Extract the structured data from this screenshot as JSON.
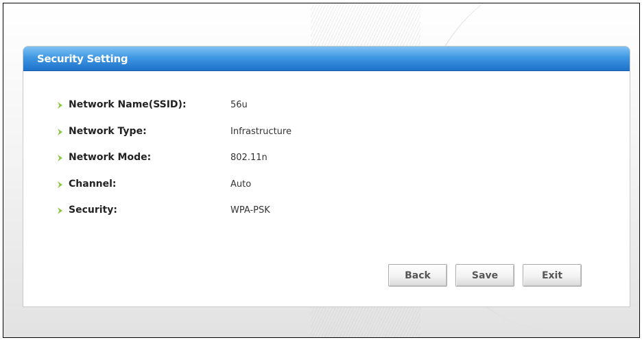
{
  "panel": {
    "title": "Security Setting"
  },
  "rows": [
    {
      "label": "Network Name(SSID):",
      "value": "56u"
    },
    {
      "label": "Network Type:",
      "value": "Infrastructure"
    },
    {
      "label": "Network Mode:",
      "value": "802.11n"
    },
    {
      "label": "Channel:",
      "value": "Auto"
    },
    {
      "label": "Security:",
      "value": "WPA-PSK"
    }
  ],
  "buttons": {
    "back": "Back",
    "save": "Save",
    "exit": "Exit"
  },
  "colors": {
    "header_blue": "#2f86d8",
    "bullet_green": "#8cc63e"
  },
  "icons": {
    "bullet": "chevron-right-icon"
  }
}
